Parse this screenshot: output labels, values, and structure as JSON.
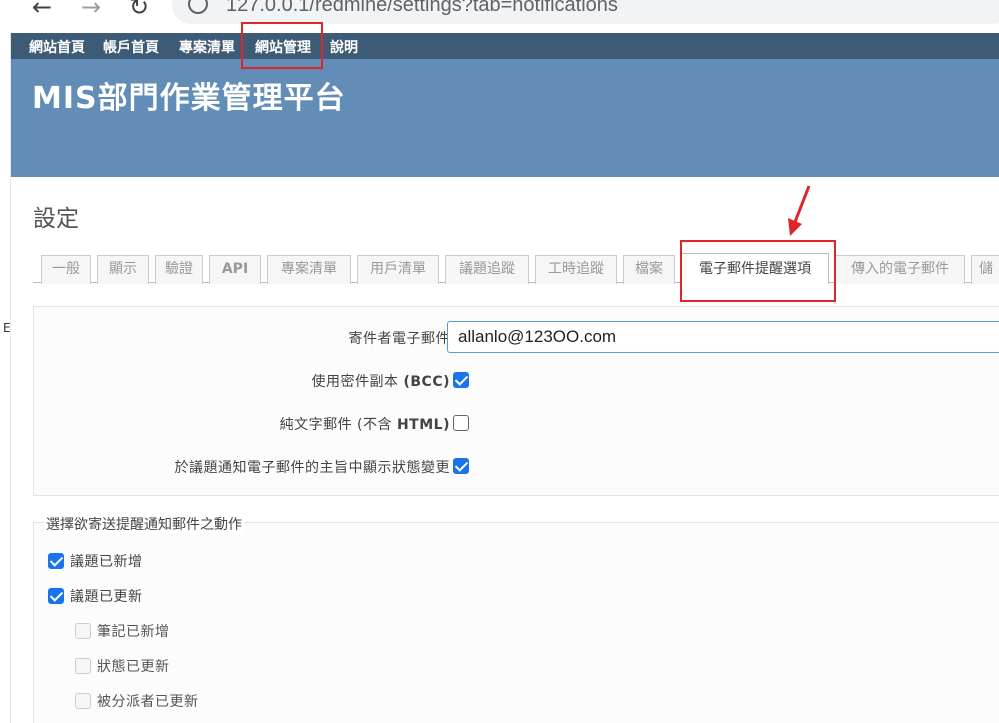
{
  "browser": {
    "back": "←",
    "forward": "→",
    "reload": "↻",
    "url": "127.0.0.1/redmine/settings?tab=notifications"
  },
  "left_edge_mark": "E",
  "top_menu": [
    {
      "label": "網站首頁"
    },
    {
      "label": "帳戶首頁"
    },
    {
      "label": "專案清單"
    },
    {
      "label": "網站管理"
    },
    {
      "label": "說明"
    }
  ],
  "header": {
    "title": "MIS部門作業管理平台"
  },
  "page": {
    "title": "設定"
  },
  "tabs": [
    {
      "label": "一般"
    },
    {
      "label": "顯示"
    },
    {
      "label": "驗證"
    },
    {
      "label": "API"
    },
    {
      "label": "專案清單"
    },
    {
      "label": "用戶清單"
    },
    {
      "label": "議題追蹤"
    },
    {
      "label": "工時追蹤"
    },
    {
      "label": "檔案"
    },
    {
      "label": "電子郵件提醒選項",
      "selected": true
    },
    {
      "label": "傳入的電子郵件"
    },
    {
      "label": "儲"
    }
  ],
  "settings": {
    "sender_label": "寄件者電子郵件",
    "sender_value": "allanlo@123OO.com",
    "bcc_label": "使用密件副本",
    "bcc_suffix": "(BCC)",
    "bcc_checked": true,
    "plain_label": "純文字郵件 (不含",
    "plain_suffix": "HTML)",
    "plain_checked": false,
    "status_label": "於議題通知電子郵件的主旨中顯示狀態變更",
    "status_checked": true
  },
  "actions": {
    "legend": "選擇欲寄送提醒通知郵件之動作",
    "items": [
      {
        "label": "議題已新增",
        "checked": true
      },
      {
        "label": "議題已更新",
        "checked": true
      },
      {
        "label": "筆記已新增",
        "checked": false
      },
      {
        "label": "狀態已更新",
        "checked": false
      },
      {
        "label": "被分派者已更新",
        "checked": false
      }
    ]
  },
  "colors": {
    "menu_bg": "#3e5b76",
    "header_bg": "#628db6",
    "annotation": "#e0242b",
    "checkbox": "#1a73e8"
  }
}
